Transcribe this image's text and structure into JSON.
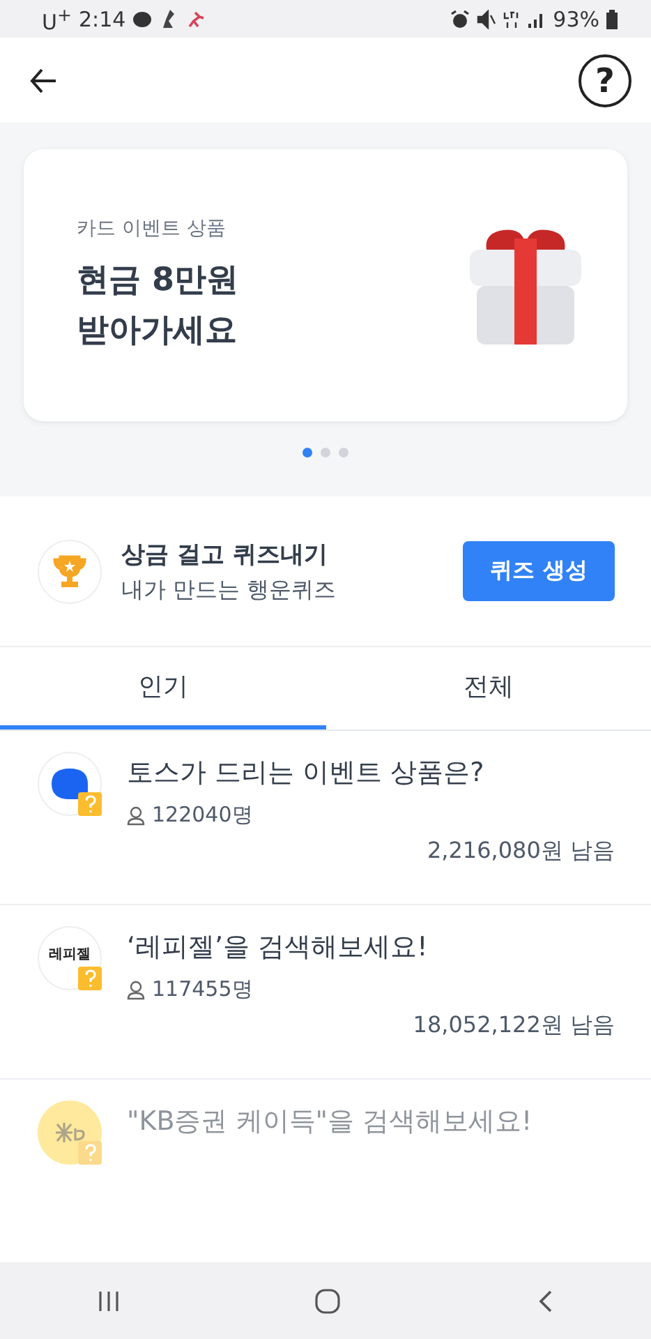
{
  "status_bar": {
    "carrier": "U$^{+}$",
    "time": "2:14",
    "battery": "93%"
  },
  "header": {
    "help": "?"
  },
  "banner": {
    "caption": "카드 이벤트 상품",
    "title_lines": [
      "현금 **8**만원",
      "받아가세요"
    ],
    "pages": [
      {
        "selected": true
      },
      {
        "selected": false
      },
      {
        "selected": false
      }
    ]
  },
  "quiz_promo": {
    "title": "상금 걸고 퀴즈내기",
    "subtitle": "내가 만드는 행운퀴즈",
    "button": "퀴즈 생성"
  },
  "tabs": [
    {
      "label": "인기",
      "selected": true
    },
    {
      "label": "전체",
      "selected": false
    }
  ],
  "quizzes": [
    {
      "kind": "bubble",
      "title": "토스가 드리는 이벤트 상품은?",
      "participants": "122040명",
      "remaining": "2,216,080원 남음",
      "dimmed": false
    },
    {
      "kind": "text",
      "logo_text": "레피젤",
      "title": "‘레피젤’을 검색해보세요!",
      "participants": "117455명",
      "remaining": "18,052,122원 남음",
      "dimmed": false
    },
    {
      "kind": "kb",
      "title": "\"KB증권 케이득\"을 검색해보세요!",
      "dimmed": true
    }
  ]
}
